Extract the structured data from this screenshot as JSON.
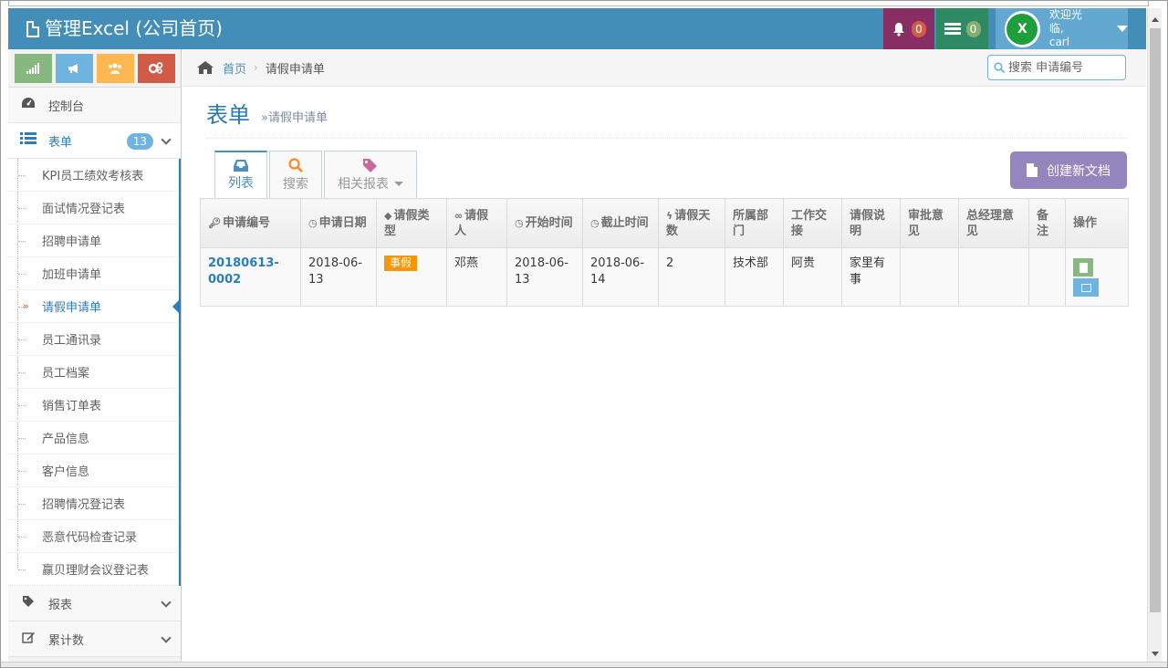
{
  "app": {
    "title": "管理Excel (公司首页)",
    "notifications_count": "0",
    "messages_count": "0",
    "user_greeting": "欢迎光临,",
    "user_name": "carl",
    "avatar_letter": "X"
  },
  "sidebar": {
    "items": [
      {
        "label": "控制台",
        "icon": "dashboard-icon"
      },
      {
        "label": "表单",
        "icon": "list-icon",
        "badge": "13"
      },
      {
        "label": "报表",
        "icon": "tag-icon"
      },
      {
        "label": "累计数",
        "icon": "edit-icon"
      }
    ],
    "subitems": [
      "KPI员工绩效考核表",
      "面试情况登记表",
      "招聘申请单",
      "加班申请单",
      "请假申请单",
      "员工通讯录",
      "员工档案",
      "销售订单表",
      "产品信息",
      "客户信息",
      "招聘情况登记表",
      "恶意代码检查记录",
      "赢贝理财会议登记表"
    ]
  },
  "breadcrumb": {
    "home": "首页",
    "current": "请假申请单"
  },
  "search": {
    "placeholder": "搜索 申请编号"
  },
  "page": {
    "title": "表单",
    "subtitle": "»请假申请单",
    "create_button": "创建新文档"
  },
  "tabs": [
    {
      "label": "列表",
      "icon": "inbox-icon"
    },
    {
      "label": "搜索",
      "icon": "search-icon"
    },
    {
      "label": "相关报表",
      "icon": "tags-icon"
    }
  ],
  "table": {
    "headers": [
      "申请编号",
      "申请日期",
      "请假类型",
      "请假人",
      "开始时间",
      "截止时间",
      "请假天数",
      "所属部门",
      "工作交接",
      "请假说明",
      "审批意见",
      "总经理意见",
      "备注",
      "操作"
    ],
    "rows": [
      {
        "id": "20180613-0002",
        "date": "2018-06-13",
        "type": "事假",
        "person": "邓燕",
        "start": "2018-06-13",
        "end": "2018-06-14",
        "days": "2",
        "dept": "技术部",
        "handover": "阿贵",
        "reason": "家里有事",
        "approval": "",
        "gm_opinion": "",
        "remark": ""
      }
    ]
  },
  "colors": {
    "navbar": "#438eb9",
    "accent": "#2b7dbc",
    "create_button": "#9585bf",
    "label_orange": "#f89406"
  }
}
